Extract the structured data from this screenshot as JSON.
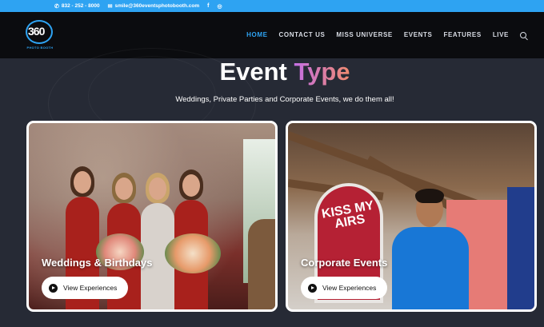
{
  "topbar": {
    "phone": "832 - 252 - 8000",
    "email": "smile@360eventsphotobooth.com",
    "social": [
      "f",
      "◎"
    ]
  },
  "logo": {
    "number": "360",
    "tagline": "PHOTO BOOTH"
  },
  "nav": {
    "items": [
      {
        "label": "HOME",
        "active": true
      },
      {
        "label": "CONTACT US",
        "active": false
      },
      {
        "label": "MISS UNIVERSE",
        "active": false
      },
      {
        "label": "EVENTS",
        "active": false
      },
      {
        "label": "FEATURES",
        "active": false
      },
      {
        "label": "LIVE",
        "active": false
      }
    ]
  },
  "hero": {
    "title_main": "Event",
    "title_accent": "Type",
    "subtitle": "Weddings, Private Parties and Corporate Events, we do them all!"
  },
  "cards": [
    {
      "label": "Weddings & Birthdays",
      "button": "View Experiences"
    },
    {
      "label": "Corporate Events",
      "button": "View Experiences",
      "sign_text": "KISS MY AIRS"
    }
  ],
  "colors": {
    "accent": "#2ea3f2",
    "background": "#262a35",
    "header": "#0b0c0f"
  }
}
